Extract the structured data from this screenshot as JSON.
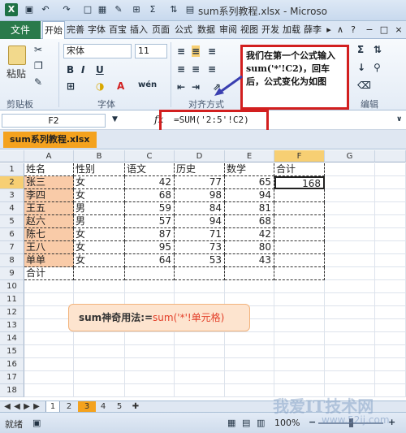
{
  "app": {
    "title": "sum系列教程.xlsx - Microso",
    "icon": "excel-logo-icon"
  },
  "quick_access": [
    "save-icon",
    "undo-icon",
    "redo-icon",
    "new-icon",
    "open-icon",
    "format-painter-icon",
    "table-icon",
    "sum-icon",
    "sort-icon",
    "text-icon"
  ],
  "tabs": {
    "file": "文件",
    "items": [
      "开始",
      "完善",
      "字体",
      "百宝",
      "插入",
      "页面",
      "公式",
      "数据",
      "审阅",
      "视图",
      "开发",
      "加载",
      "薛李"
    ],
    "active_index": 0
  },
  "ribbon": {
    "paste": "粘贴",
    "clipboard_group": "剪贴板",
    "font_name": "宋体",
    "font_size": "11",
    "font_group": "字体",
    "align_group": "对齐方式",
    "edit_group": "编辑",
    "bold": "B",
    "italic": "I",
    "underline": "U",
    "font_color_letter": "A",
    "wen": "wén"
  },
  "callout": {
    "text": "我们在第一个公式输入sum('*'!C2)，回车后，公式变化为如图"
  },
  "formula_bar": {
    "name_box": "F2",
    "fx": "fx",
    "formula": "=SUM('2:5'!C2)"
  },
  "workbook_tab": "sum系列教程.xlsx",
  "grid": {
    "columns": [
      "A",
      "B",
      "C",
      "D",
      "E",
      "F",
      "G"
    ],
    "rows": [
      "1",
      "2",
      "3",
      "4",
      "5",
      "6",
      "7",
      "8",
      "9",
      "10",
      "11",
      "12",
      "13",
      "14",
      "15",
      "16",
      "17",
      "18"
    ],
    "header": [
      "姓名",
      "性别",
      "语文",
      "历史",
      "数学",
      "合计"
    ],
    "data": [
      [
        "张三",
        "女",
        "42",
        "77",
        "65",
        "168"
      ],
      [
        "李四",
        "女",
        "68",
        "98",
        "94",
        ""
      ],
      [
        "王五",
        "男",
        "59",
        "84",
        "81",
        ""
      ],
      [
        "赵六",
        "男",
        "57",
        "94",
        "68",
        ""
      ],
      [
        "陈七",
        "女",
        "87",
        "71",
        "42",
        ""
      ],
      [
        "王八",
        "女",
        "95",
        "73",
        "80",
        ""
      ],
      [
        "单单",
        "女",
        "64",
        "53",
        "43",
        ""
      ]
    ],
    "total_label": "合计"
  },
  "tip": {
    "prefix": "sum神奇用法:=",
    "formula": "sum('*'!单元格)"
  },
  "sheets": [
    "1",
    "2",
    "3",
    "4",
    "5"
  ],
  "active_sheet": "3",
  "status": {
    "ready": "就绪",
    "zoom": "100%",
    "zoom_value": 1.0
  },
  "watermark": {
    "text": "我爱IT技术网",
    "url": "www.52ij.com"
  },
  "colors": {
    "accent": "#2a7a4b",
    "highlight": "#d21f1f",
    "selected_header": "#f7cf73",
    "name_fill": "#f9cba8",
    "tip_bg": "#fde4cf"
  }
}
